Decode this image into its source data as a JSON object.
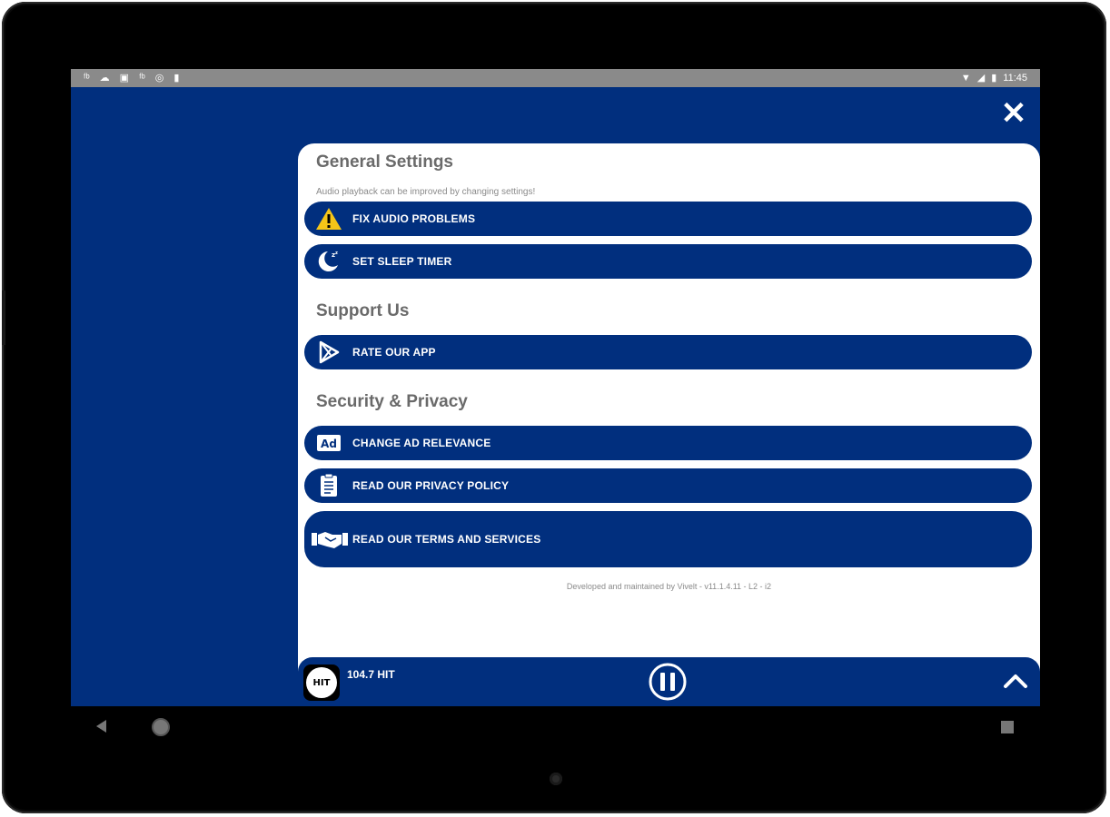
{
  "status_bar": {
    "left_icons": [
      "fb-icon",
      "cloud-icon",
      "box-icon",
      "fb-icon",
      "sync-icon",
      "clipboard-icon"
    ],
    "time": "11:45"
  },
  "sections": {
    "general": {
      "title": "General Settings",
      "subtitle": "Audio playback can be improved by changing settings!"
    },
    "support": {
      "title": "Support Us"
    },
    "security": {
      "title": "Security & Privacy"
    }
  },
  "buttons": {
    "fix_audio": "FIX AUDIO PROBLEMS",
    "sleep_timer": "SET SLEEP TIMER",
    "rate_app": "RATE OUR APP",
    "ad_relevance": "CHANGE AD RELEVANCE",
    "privacy_policy": "READ OUR PRIVACY POLICY",
    "terms": "READ OUR TERMS AND SERVICES"
  },
  "icons": {
    "ad_badge": "Ad"
  },
  "footer_note": "Developed and maintained by Vivelt - v11.1.4.11 - L2 - i2",
  "player": {
    "station_name": "104.7 HIT",
    "logo_text": "HIT"
  },
  "colors": {
    "brand_blue": "#012f7e",
    "warning_yellow": "#f5c518"
  }
}
